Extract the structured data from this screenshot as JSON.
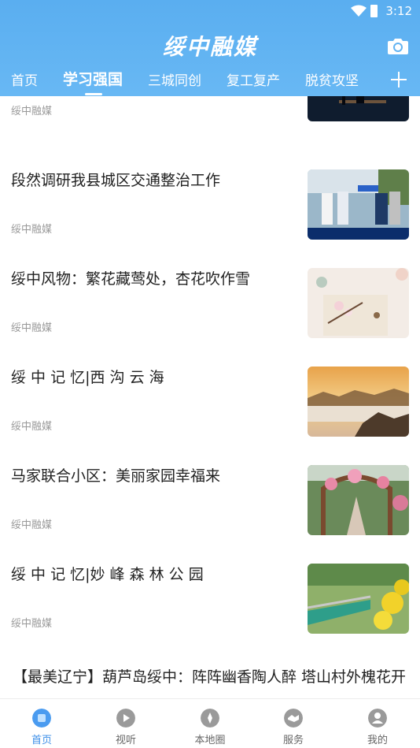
{
  "status_bar": {
    "time": "3:12"
  },
  "header": {
    "app_title": "绥中融媒"
  },
  "tabs": [
    {
      "label": "首页"
    },
    {
      "label": "学习强国"
    },
    {
      "label": "三城同创"
    },
    {
      "label": "复工复产"
    },
    {
      "label": "脱贫攻坚"
    }
  ],
  "feed": {
    "items": [
      {
        "title": "",
        "source": "绥中融媒"
      },
      {
        "title": "段然调研我县城区交通整治工作",
        "source": "绥中融媒"
      },
      {
        "title": "绥中风物：繁花藏莺处，杏花吹作雪",
        "source": "绥中融媒"
      },
      {
        "title": "绥 中 记 忆|西 沟 云 海",
        "source": "绥中融媒"
      },
      {
        "title": "马家联合小区：美丽家园幸福来",
        "source": "绥中融媒"
      },
      {
        "title": "绥 中 记 忆|妙 峰 森 林 公 园",
        "source": "绥中融媒"
      }
    ],
    "wide_item": {
      "title": "【最美辽宁】葫芦岛绥中：阵阵幽香陶人醉 塔山村外槐花开"
    }
  },
  "bottom_nav": [
    {
      "label": "首页",
      "icon": "home-icon"
    },
    {
      "label": "视听",
      "icon": "play-icon"
    },
    {
      "label": "本地圈",
      "icon": "compass-icon"
    },
    {
      "label": "服务",
      "icon": "handshake-icon"
    },
    {
      "label": "我的",
      "icon": "user-icon"
    }
  ],
  "colors": {
    "header": "#5aaef0",
    "accent": "#3d8fe8",
    "source_text": "#999999"
  }
}
